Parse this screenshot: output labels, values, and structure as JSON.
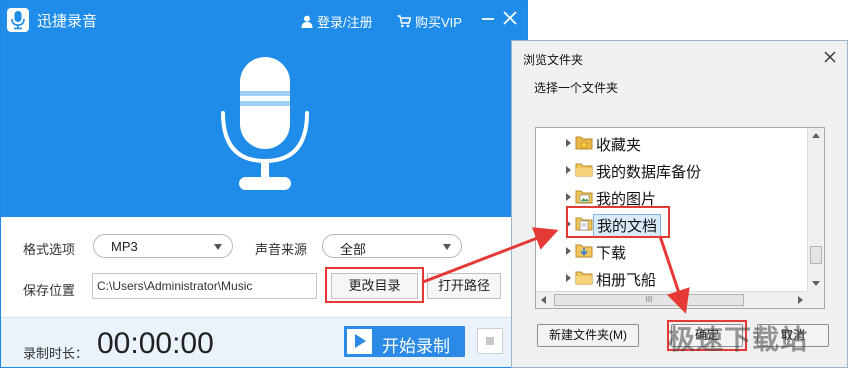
{
  "app": {
    "title": "迅捷录音",
    "login_label": "登录/注册",
    "vip_label": "购买VIP",
    "icons": {
      "app": "microphone-icon",
      "user": "user-icon",
      "cart": "cart-icon",
      "minimize": "minimize-icon",
      "close": "close-icon"
    },
    "colors": {
      "header": "#1e8ce8",
      "accent": "#2a8ae6",
      "highlight": "#e53935"
    },
    "format": {
      "label": "格式选项",
      "value": "MP3"
    },
    "source": {
      "label": "声音来源",
      "value": "全部"
    },
    "save": {
      "label": "保存位置",
      "path": "C:\\Users\\Administrator\\Music",
      "change_dir": "更改目录",
      "open_path": "打开路径"
    },
    "record": {
      "duration_label": "录制时长：",
      "time": "00:00:00",
      "start_label": "开始录制"
    }
  },
  "dialog": {
    "title": "浏览文件夹",
    "prompt": "选择一个文件夹",
    "tree_items": [
      {
        "label": "收藏夹",
        "icon": "favorites-folder-icon"
      },
      {
        "label": "我的数据库备份",
        "icon": "folder-icon"
      },
      {
        "label": "我的图片",
        "icon": "pictures-folder-icon"
      },
      {
        "label": "我的文档",
        "icon": "documents-folder-icon",
        "selected": true
      },
      {
        "label": "下载",
        "icon": "downloads-folder-icon"
      },
      {
        "label": "相册飞船",
        "icon": "folder-icon"
      }
    ],
    "scrollbar_grip": "III",
    "new_folder_label": "新建文件夹(M)",
    "ok_label": "确定",
    "cancel_label": "取消"
  },
  "watermark": "极速下载站"
}
